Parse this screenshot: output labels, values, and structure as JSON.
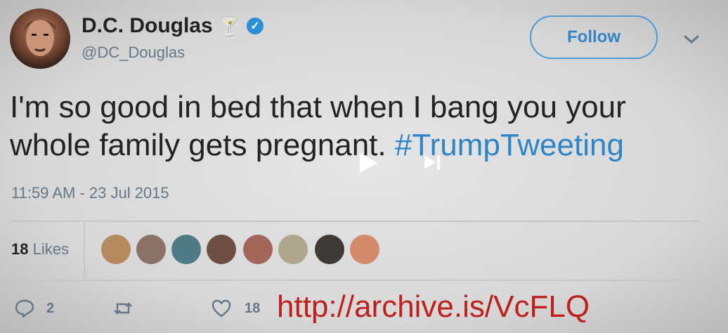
{
  "user": {
    "display_name": "D.C. Douglas",
    "name_emoji": "🍸",
    "handle": "@DC_Douglas"
  },
  "follow_label": "Follow",
  "tweet": {
    "text": "I'm so good in bed that when I bang you your whole family gets pregnant. ",
    "hashtag": "#TrumpTweeting"
  },
  "timestamp": "11:59 AM - 23 Jul 2015",
  "likes": {
    "count": "18",
    "label": "Likes"
  },
  "actions": {
    "replies": "2",
    "likes": "18"
  },
  "overlay_url": "http://archive.is/VcFLQ",
  "colors": {
    "link_blue": "#2d85c8",
    "verified_blue": "#2d8fd5",
    "url_red": "#c0201c",
    "muted_gray": "#657786"
  },
  "icons": [
    "verified-badge-icon",
    "chevron-down-icon",
    "reply-icon",
    "retweet-icon",
    "heart-icon",
    "play-icon",
    "skip-next-icon"
  ],
  "liker_avatars": [
    {
      "color": "#b58a5e"
    },
    {
      "color": "#8a7266"
    },
    {
      "color": "#4f7b86"
    },
    {
      "color": "#6d5043"
    },
    {
      "color": "#a3665a"
    },
    {
      "color": "#b0a68c"
    },
    {
      "color": "#3f3a36"
    },
    {
      "color": "#d48a6a"
    }
  ]
}
